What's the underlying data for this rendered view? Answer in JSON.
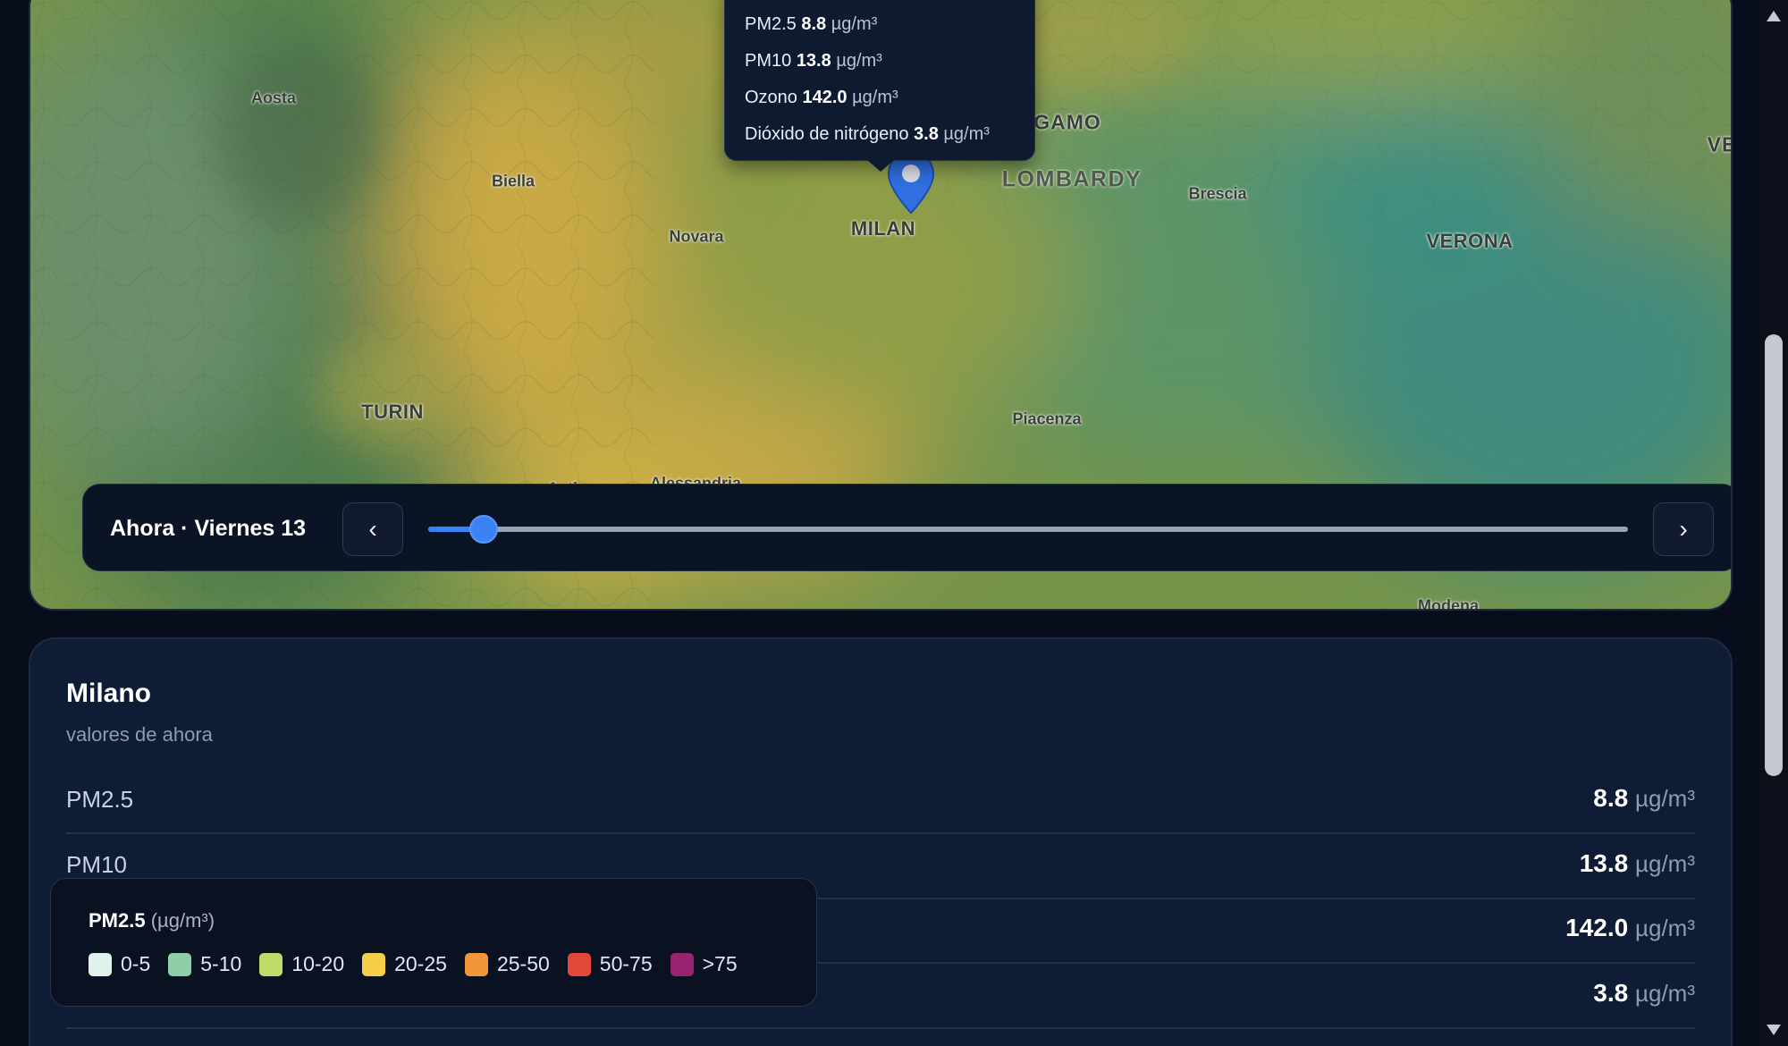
{
  "map": {
    "labels": [
      {
        "text": "Aosta",
        "kind": "town"
      },
      {
        "text": "Biella",
        "kind": "town"
      },
      {
        "text": "Novara",
        "kind": "town"
      },
      {
        "text": "MILAN",
        "kind": "city"
      },
      {
        "text": "LOMBARDY",
        "kind": "region"
      },
      {
        "text": "Brescia",
        "kind": "town"
      },
      {
        "text": "VERONA",
        "kind": "city"
      },
      {
        "text": "TURIN",
        "kind": "city"
      },
      {
        "text": "Piacenza",
        "kind": "town"
      },
      {
        "text": "Asti",
        "kind": "town"
      },
      {
        "text": "Alessandria",
        "kind": "town"
      },
      {
        "text": "Modena",
        "kind": "town"
      },
      {
        "text": "GAMO",
        "kind": "cut"
      },
      {
        "text": "VE",
        "kind": "cut"
      },
      {
        "text": "A",
        "kind": "cut"
      }
    ]
  },
  "tooltip": {
    "rows": [
      {
        "name": "PM2.5",
        "value": "8.8",
        "unit": "µg/m³"
      },
      {
        "name": "PM10",
        "value": "13.8",
        "unit": "µg/m³"
      },
      {
        "name": "Ozono",
        "value": "142.0",
        "unit": "µg/m³"
      },
      {
        "name": "Dióxido de nitrógeno",
        "value": "3.8",
        "unit": "µg/m³"
      }
    ]
  },
  "time_bar": {
    "label": "Ahora · Viernes 13",
    "prev_icon": "chevron-left-icon",
    "prev_glyph": "‹",
    "next_icon": "chevron-right-icon",
    "next_glyph": "›",
    "slider_fraction": 0.046
  },
  "details": {
    "title": "Milano",
    "subtitle": "valores de ahora",
    "metrics": [
      {
        "name": "PM2.5",
        "value": "8.8",
        "unit": "µg/m³"
      },
      {
        "name": "PM10",
        "value": "13.8",
        "unit": "µg/m³"
      },
      {
        "name": "",
        "value": "142.0",
        "unit": "µg/m³"
      },
      {
        "name": "",
        "value": "3.8",
        "unit": "µg/m³"
      }
    ]
  },
  "legend": {
    "title": "PM2.5",
    "unit": "(µg/m³)",
    "items": [
      {
        "label": "0-5",
        "color": "#dff3ea"
      },
      {
        "label": "5-10",
        "color": "#8fcfa6"
      },
      {
        "label": "10-20",
        "color": "#bfdc6a"
      },
      {
        "label": "20-25",
        "color": "#f6cf4a"
      },
      {
        "label": "25-50",
        "color": "#f2963b"
      },
      {
        "label": "50-75",
        "color": "#e2473b"
      },
      {
        "label": ">75",
        "color": "#98246f"
      }
    ]
  },
  "colors": {
    "accent": "#3b82f6",
    "background": "#070d1a",
    "panel": "#0f1c36"
  }
}
